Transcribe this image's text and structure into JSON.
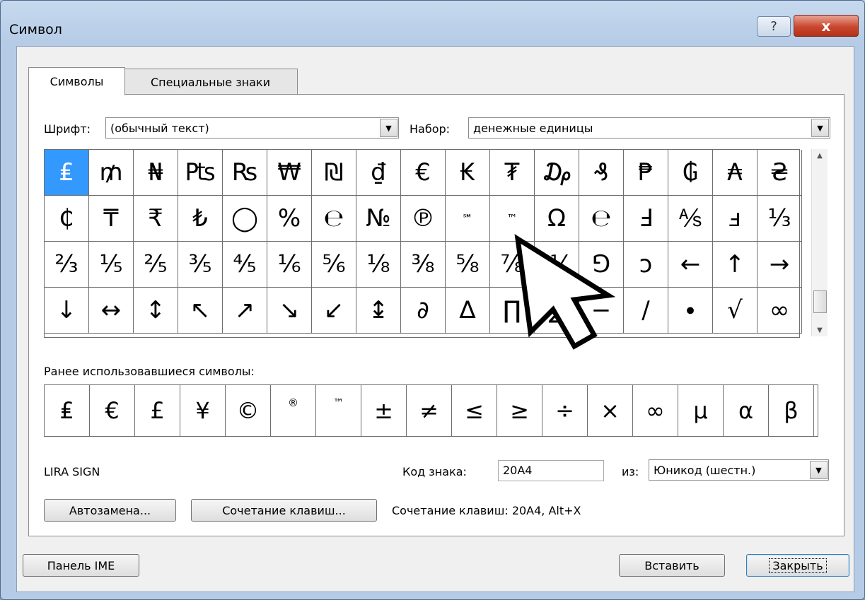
{
  "window": {
    "title": "Символ",
    "help_label": "?",
    "close_label": "x"
  },
  "tabs": [
    {
      "label": "Символы"
    },
    {
      "label": "Специальные знаки"
    }
  ],
  "font": {
    "label": "Шрифт:",
    "value": "(обычный текст)"
  },
  "subset": {
    "label": "Набор:",
    "value": "денежные единицы"
  },
  "symbol_grid": {
    "rows": [
      [
        "₤",
        "₥",
        "₦",
        "₧",
        "₨",
        "₩",
        "₪",
        "₫",
        "€",
        "₭",
        "₮",
        "₯",
        "₰",
        "₱",
        "₲",
        "₳",
        "₴"
      ],
      [
        "₵",
        "₸",
        "₹",
        "₺",
        "◯",
        "%",
        "℮",
        "№",
        "℗",
        "℠",
        "™",
        "Ω",
        "℮",
        "Ⅎ",
        "⅍",
        "ⅎ",
        "⅓"
      ],
      [
        "⅔",
        "⅕",
        "⅖",
        "⅗",
        "⅘",
        "⅙",
        "⅚",
        "⅛",
        "⅜",
        "⅝",
        "⅞",
        "⅟",
        "⅁",
        "ↄ",
        "←",
        "↑",
        "→"
      ],
      [
        "↓",
        "↔",
        "↕",
        "↖",
        "↗",
        "↘",
        "↙",
        "↨",
        "∂",
        "∆",
        "∏",
        "∑",
        "−",
        "∕",
        "∙",
        "√",
        "∞"
      ]
    ],
    "selected_index": 0
  },
  "recent": {
    "label": "Ранее использовавшиеся символы:",
    "items": [
      "₤",
      "€",
      "£",
      "¥",
      "©",
      "®",
      "™",
      "±",
      "≠",
      "≤",
      "≥",
      "÷",
      "×",
      "∞",
      "μ",
      "α",
      "β"
    ]
  },
  "char_name": "LIRA SIGN",
  "char_code": {
    "label": "Код знака:",
    "value": "20A4"
  },
  "from": {
    "label": "из:",
    "value": "Юникод (шестн.)"
  },
  "buttons": {
    "autocorrect": "Автозамена...",
    "shortcut_key": "Сочетание клавиш...",
    "ime_pad": "Панель IME",
    "insert": "Вставить",
    "close": "Закрыть"
  },
  "shortcut_text": "Сочетание клавиш: 20A4, Alt+X",
  "icons": {
    "dropdown": "dropdown-arrow-icon",
    "cursor": "mouse-pointer-icon"
  }
}
